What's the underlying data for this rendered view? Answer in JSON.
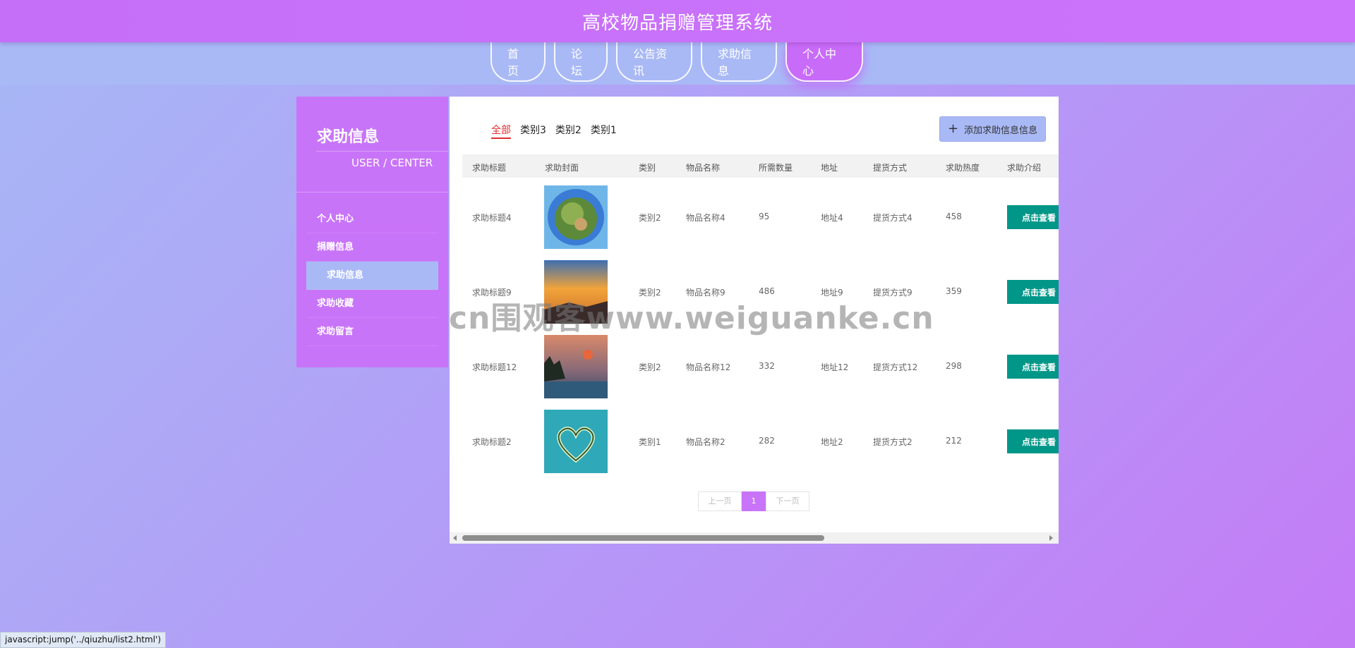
{
  "header": {
    "title": "高校物品捐赠管理系统"
  },
  "nav": [
    {
      "label": "首页"
    },
    {
      "label": "论坛"
    },
    {
      "label": "公告资讯"
    },
    {
      "label": "求助信息"
    },
    {
      "label": "个人中心",
      "active": true
    }
  ],
  "sidebar": {
    "title": "求助信息",
    "subtitle": "USER / CENTER",
    "items": [
      {
        "label": "个人中心"
      },
      {
        "label": "捐赠信息"
      },
      {
        "label": "求助信息",
        "active": true
      },
      {
        "label": "求助收藏"
      },
      {
        "label": "求助留言"
      }
    ]
  },
  "categories": [
    {
      "label": "全部",
      "active": true
    },
    {
      "label": "类别3"
    },
    {
      "label": "类别2"
    },
    {
      "label": "类别1"
    }
  ],
  "add_button": {
    "label": "添加求助信息信息",
    "icon": "plus-icon"
  },
  "table": {
    "headers": [
      "求助标题",
      "求助封面",
      "类别",
      "物品名称",
      "所需数量",
      "地址",
      "提货方式",
      "求助热度",
      "求助介绍"
    ],
    "rows": [
      {
        "title": "求助标题4",
        "category": "类别2",
        "item": "物品名称4",
        "qty": "95",
        "address": "地址4",
        "pickup": "提货方式4",
        "heat": "458",
        "action": "点击查看"
      },
      {
        "title": "求助标题9",
        "category": "类别2",
        "item": "物品名称9",
        "qty": "486",
        "address": "地址9",
        "pickup": "提货方式9",
        "heat": "359",
        "action": "点击查看"
      },
      {
        "title": "求助标题12",
        "category": "类别2",
        "item": "物品名称12",
        "qty": "332",
        "address": "地址12",
        "pickup": "提货方式12",
        "heat": "298",
        "action": "点击查看"
      },
      {
        "title": "求助标题2",
        "category": "类别1",
        "item": "物品名称2",
        "qty": "282",
        "address": "地址2",
        "pickup": "提货方式2",
        "heat": "212",
        "action": "点击查看"
      }
    ]
  },
  "pager": {
    "prev": "上一页",
    "current": "1",
    "next": "下一页"
  },
  "watermark": "cn围观客www.weiguanke.cn",
  "statusbar": "javascript:jump('../qiuzhu/list2.html')",
  "colors": {
    "accent": "#c874f8",
    "nav_band": "#a9b9f6",
    "view_button": "#009688",
    "active_category": "#e02d2d"
  }
}
